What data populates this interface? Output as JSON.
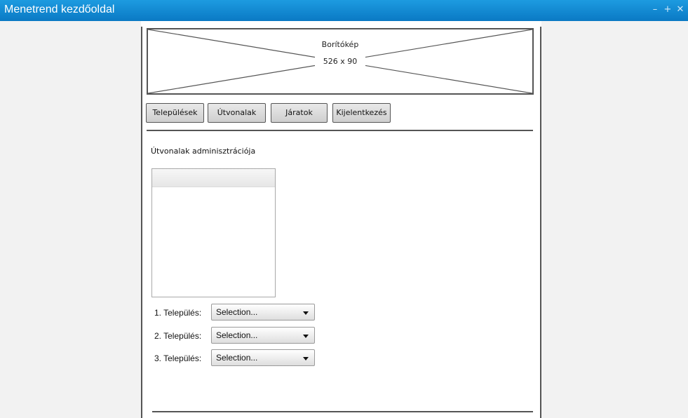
{
  "window": {
    "title": "Menetrend kezdőoldal",
    "controls": [
      {
        "name": "minimize",
        "icon": "minus-icon",
        "glyph": "–"
      },
      {
        "name": "maximize",
        "icon": "plus-icon",
        "glyph": "+"
      },
      {
        "name": "close",
        "icon": "close-icon",
        "glyph": "✕"
      }
    ]
  },
  "cover": {
    "title": "Borítókép",
    "size": "526 x 90"
  },
  "nav": {
    "items": [
      {
        "label": "Települések"
      },
      {
        "label": "Útvonalak"
      },
      {
        "label": "Járatok"
      },
      {
        "label": "Kijelentkezés"
      }
    ]
  },
  "main": {
    "section_title": "Útvonalak adminisztrációja",
    "fields": [
      {
        "label": "1. Település:",
        "value": "Selection..."
      },
      {
        "label": "2. Település:",
        "value": "Selection..."
      },
      {
        "label": "3.  Település:",
        "value": "Selection..."
      }
    ]
  },
  "colors": {
    "titlebar": "#0a79c4",
    "background": "#f2f2f2",
    "border": "#555555"
  }
}
